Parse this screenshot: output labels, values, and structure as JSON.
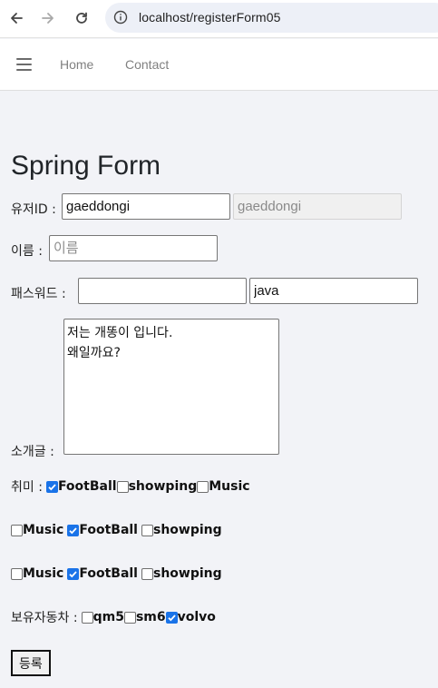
{
  "browser": {
    "url": "localhost/registerForm05"
  },
  "navbar": {
    "links": [
      "Home",
      "Contact"
    ]
  },
  "form": {
    "title": "Spring Form",
    "userid_label": "유저ID :",
    "userid_value": "gaeddongi",
    "userid_disabled_value": "gaeddongi",
    "name_label": "이름 :",
    "name_placeholder": "이름",
    "password_label": "패스워드 :",
    "password_value": "",
    "password_text_value": "java",
    "intro_label": "소개글 :",
    "intro_value": "저는 개똥이 입니다.\n왜일까요?",
    "hobby_label": "취미 :",
    "hobby_group1": [
      {
        "label": "FootBall",
        "checked": true
      },
      {
        "label": "showping",
        "checked": false
      },
      {
        "label": "Music",
        "checked": false
      }
    ],
    "hobby_group2": [
      {
        "label": "Music",
        "checked": false
      },
      {
        "label": "FootBall",
        "checked": true
      },
      {
        "label": "showping",
        "checked": false
      }
    ],
    "hobby_group3": [
      {
        "label": "Music",
        "checked": false
      },
      {
        "label": "FootBall",
        "checked": true
      },
      {
        "label": "showping",
        "checked": false
      }
    ],
    "car_label": "보유자동차 :",
    "cars": [
      {
        "label": "qm5",
        "checked": false
      },
      {
        "label": "sm6",
        "checked": false
      },
      {
        "label": "volvo",
        "checked": true
      }
    ],
    "submit_label": "등록"
  }
}
